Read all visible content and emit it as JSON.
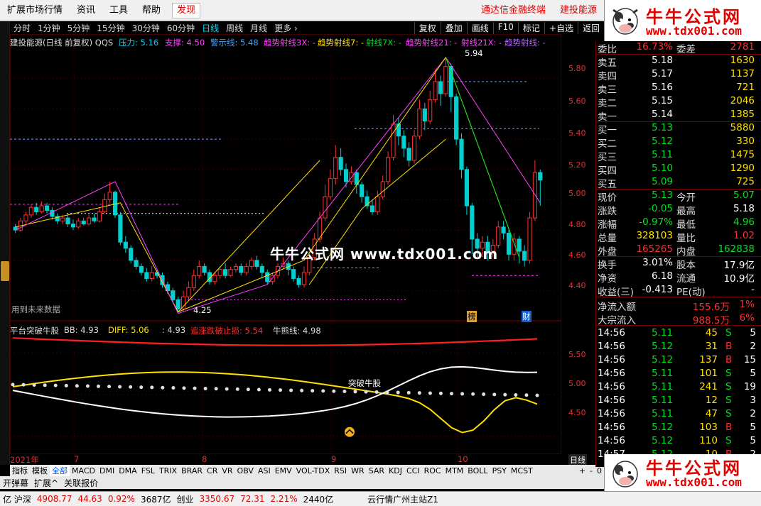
{
  "menu": {
    "items": [
      "扩展市场行情",
      "资讯",
      "工具",
      "帮助"
    ],
    "discover": "发现",
    "ad1": "通达信金融终端",
    "ad2": "建投能源"
  },
  "logo": {
    "title": "牛牛公式网",
    "url": "www.tdx001.com"
  },
  "periods": [
    "分时",
    "1分钟",
    "5分钟",
    "15分钟",
    "30分钟",
    "60分钟",
    "日线",
    "周线",
    "月线",
    "更多 ›"
  ],
  "active_period": "日线",
  "toolbar": [
    "复权",
    "叠加",
    "画线",
    "F10",
    "标记",
    "+自选",
    "返回"
  ],
  "main_legend": {
    "stock": "建投能源(日线 前复权) QQS",
    "pressure": "压力: 5.16",
    "support": "支撑: 4.50",
    "warn": "警示线: 5.48",
    "ray3": "趋势射线3X: -",
    "ray7": "趋势射线7: -",
    "ray7x": "射线7X: -",
    "ray21": "趋势射线21: -",
    "ray21x": "射线21X: -",
    "ray": "趋势射线: -"
  },
  "chart_labels": {
    "high": "5.94",
    "low": "4.25",
    "future": "用到未来数据",
    "watermark": "牛牛公式网 www.tdx001.com",
    "badge1": "榜",
    "badge2": "财"
  },
  "sub_legend": {
    "name": "平台突破牛股",
    "bb": "BB: 4.93",
    "diff": "DIFF: 5.06",
    "v3": ": 4.93",
    "stop": "追涨跌破止损: 5.54",
    "niu": "牛熊线: 4.98",
    "breakout": "突破牛股"
  },
  "x_axis": {
    "year": "2021年",
    "m7": "7",
    "m8": "8",
    "m9": "9",
    "m10": "10",
    "period_tag": "日线"
  },
  "price_axis": [
    "5.80",
    "5.60",
    "5.40",
    "5.20",
    "5.00",
    "4.80",
    "4.60",
    "4.40"
  ],
  "sub_axis": [
    "5.50",
    "5.00",
    "4.50"
  ],
  "indicator_tabs": [
    "指标",
    "模板",
    "全部",
    "MACD",
    "DMI",
    "DMA",
    "FSL",
    "TRIX",
    "BRAR",
    "CR",
    "VR",
    "OBV",
    "ASI",
    "EMV",
    "VOL-TDX",
    "RSI",
    "WR",
    "SAR",
    "KDJ",
    "CCI",
    "ROC",
    "MTM",
    "BOLL",
    "PSY",
    "MCST"
  ],
  "active_indicator": "全部",
  "bottom_tabs": [
    "开弹幕",
    "扩展^",
    "关联报价"
  ],
  "zoom_controls": [
    "+",
    "-",
    "0"
  ],
  "status": {
    "sh_label": "亿 沪深",
    "sh_value": "4908.77",
    "sh_chg": "44.63",
    "sh_pct": "0.92%",
    "sh_amt": "3687亿",
    "cy_label": "创业",
    "cy_value": "3350.67",
    "cy_chg": "72.31",
    "cy_pct": "2.21%",
    "cy_amt": "2440亿",
    "server": "云行情广州主站Z1"
  },
  "quote": {
    "weibi": {
      "label": "委比",
      "pct": "16.73%",
      "label2": "委差",
      "val": "2781"
    },
    "sell": [
      {
        "label": "卖五",
        "price": "5.18",
        "vol": "1630"
      },
      {
        "label": "卖四",
        "price": "5.17",
        "vol": "1137"
      },
      {
        "label": "卖三",
        "price": "5.16",
        "vol": "721"
      },
      {
        "label": "卖二",
        "price": "5.15",
        "vol": "2046"
      },
      {
        "label": "卖一",
        "price": "5.14",
        "vol": "1385"
      }
    ],
    "buy": [
      {
        "label": "买一",
        "price": "5.13",
        "vol": "5880"
      },
      {
        "label": "买二",
        "price": "5.12",
        "vol": "330"
      },
      {
        "label": "买三",
        "price": "5.11",
        "vol": "1475"
      },
      {
        "label": "买四",
        "price": "5.10",
        "vol": "1290"
      },
      {
        "label": "买五",
        "price": "5.09",
        "vol": "725"
      }
    ],
    "stats": [
      {
        "l1": "现价",
        "v1": "5.13",
        "c1": "green",
        "l2": "今开",
        "v2": "5.07",
        "c2": "green"
      },
      {
        "l1": "涨跌",
        "v1": "-0.05",
        "c1": "green",
        "l2": "最高",
        "v2": "5.18",
        "c2": "white"
      },
      {
        "l1": "涨幅",
        "v1": "-0.97%",
        "c1": "green",
        "l2": "最低",
        "v2": "4.96",
        "c2": "green"
      },
      {
        "l1": "总量",
        "v1": "328103",
        "c1": "yellow",
        "l2": "量比",
        "v2": "1.02",
        "c2": "red"
      },
      {
        "l1": "外盘",
        "v1": "165265",
        "c1": "red",
        "l2": "内盘",
        "v2": "162838",
        "c2": "green"
      }
    ],
    "fin": [
      {
        "l1": "换手",
        "v1": "3.01%",
        "l2": "股本",
        "v2": "17.9亿"
      },
      {
        "l1": "净资",
        "v1": "6.18",
        "l2": "流通",
        "v2": "10.9亿"
      },
      {
        "l1": "收益(三)",
        "v1": "-0.413",
        "l2": "PE(动)",
        "v2": "-"
      }
    ],
    "flows": [
      {
        "label": "净流入额",
        "val": "155.6万",
        "pct": "1%"
      },
      {
        "label": "大宗流入",
        "val": "988.5万",
        "pct": "6%"
      }
    ],
    "ticks": [
      {
        "t": "14:56",
        "p": "5.11",
        "v": "45",
        "s": "S",
        "n": "5"
      },
      {
        "t": "14:56",
        "p": "5.12",
        "v": "31",
        "s": "B",
        "n": "2"
      },
      {
        "t": "14:56",
        "p": "5.12",
        "v": "137",
        "s": "B",
        "n": "15"
      },
      {
        "t": "14:56",
        "p": "5.11",
        "v": "101",
        "s": "S",
        "n": "5"
      },
      {
        "t": "14:56",
        "p": "5.11",
        "v": "241",
        "s": "S",
        "n": "19"
      },
      {
        "t": "14:56",
        "p": "5.11",
        "v": "12",
        "s": "S",
        "n": "3"
      },
      {
        "t": "14:56",
        "p": "5.11",
        "v": "47",
        "s": "S",
        "n": "2"
      },
      {
        "t": "14:56",
        "p": "5.12",
        "v": "103",
        "s": "B",
        "n": "5"
      },
      {
        "t": "14:56",
        "p": "5.12",
        "v": "110",
        "s": "S",
        "n": "5"
      },
      {
        "t": "14:57",
        "p": "5.12",
        "v": "10",
        "s": "B",
        "n": "2"
      }
    ]
  },
  "colors": {
    "up": "#ff3030",
    "down": "#00d0d0",
    "accent": "#e00000",
    "yellow": "#ffe000",
    "magenta": "#ff40ff"
  },
  "candles": [
    [
      4.82,
      4.8,
      4.84,
      4.78
    ],
    [
      4.8,
      4.86,
      4.88,
      4.79
    ],
    [
      4.86,
      4.9,
      4.92,
      4.84
    ],
    [
      4.9,
      4.95,
      4.97,
      4.88
    ],
    [
      4.95,
      4.92,
      4.98,
      4.9
    ],
    [
      4.92,
      4.96,
      4.99,
      4.91
    ],
    [
      4.96,
      4.93,
      4.98,
      4.91
    ],
    [
      4.93,
      4.89,
      4.95,
      4.87
    ],
    [
      4.89,
      4.86,
      4.91,
      4.84
    ],
    [
      4.86,
      4.88,
      4.9,
      4.84
    ],
    [
      4.88,
      4.84,
      4.9,
      4.82
    ],
    [
      4.84,
      4.82,
      4.87,
      4.8
    ],
    [
      4.82,
      4.86,
      4.88,
      4.81
    ],
    [
      4.86,
      4.84,
      4.88,
      4.83
    ],
    [
      4.84,
      4.88,
      4.9,
      4.83
    ],
    [
      4.88,
      4.86,
      4.91,
      4.85
    ],
    [
      4.86,
      4.92,
      4.95,
      4.85
    ],
    [
      4.92,
      5.0,
      5.04,
      4.91
    ],
    [
      5.0,
      5.05,
      5.12,
      4.98
    ],
    [
      5.05,
      4.9,
      5.06,
      4.88
    ],
    [
      4.9,
      4.72,
      4.92,
      4.7
    ],
    [
      4.72,
      4.68,
      4.76,
      4.65
    ],
    [
      4.68,
      4.6,
      4.7,
      4.58
    ],
    [
      4.6,
      4.56,
      4.62,
      4.54
    ],
    [
      4.56,
      4.52,
      4.58,
      4.5
    ],
    [
      4.52,
      4.48,
      4.55,
      4.46
    ],
    [
      4.48,
      4.52,
      4.56,
      4.46
    ],
    [
      4.52,
      4.5,
      4.54,
      4.48
    ],
    [
      4.5,
      4.44,
      4.52,
      4.42
    ],
    [
      4.44,
      4.4,
      4.46,
      4.38
    ],
    [
      4.4,
      4.34,
      4.42,
      4.32
    ],
    [
      4.34,
      4.28,
      4.36,
      4.25
    ],
    [
      4.28,
      4.36,
      4.4,
      4.26
    ],
    [
      4.36,
      4.42,
      4.46,
      4.34
    ],
    [
      4.42,
      4.5,
      4.54,
      4.4
    ],
    [
      4.5,
      4.56,
      4.6,
      4.48
    ],
    [
      4.56,
      4.52,
      4.58,
      4.5
    ],
    [
      4.52,
      4.46,
      4.54,
      4.44
    ],
    [
      4.46,
      4.5,
      4.52,
      4.44
    ],
    [
      4.5,
      4.54,
      4.56,
      4.48
    ],
    [
      4.54,
      4.5,
      4.58,
      4.48
    ],
    [
      4.5,
      4.54,
      4.56,
      4.49
    ],
    [
      4.54,
      4.56,
      4.58,
      4.52
    ],
    [
      4.56,
      4.52,
      4.58,
      4.5
    ],
    [
      4.52,
      4.56,
      4.58,
      4.5
    ],
    [
      4.56,
      4.6,
      4.62,
      4.54
    ],
    [
      4.6,
      4.56,
      4.63,
      4.54
    ],
    [
      4.56,
      4.52,
      4.58,
      4.48
    ],
    [
      4.52,
      4.46,
      4.54,
      4.44
    ],
    [
      4.46,
      4.5,
      4.52,
      4.44
    ],
    [
      4.5,
      4.56,
      4.58,
      4.48
    ],
    [
      4.56,
      4.58,
      4.62,
      4.54
    ],
    [
      4.58,
      4.54,
      4.6,
      4.5
    ],
    [
      4.54,
      4.48,
      4.56,
      4.46
    ],
    [
      4.48,
      4.44,
      4.5,
      4.42
    ],
    [
      4.44,
      4.52,
      4.56,
      4.42
    ],
    [
      4.52,
      4.62,
      4.66,
      4.5
    ],
    [
      4.62,
      4.74,
      4.78,
      4.6
    ],
    [
      4.74,
      4.88,
      4.92,
      4.72
    ],
    [
      4.88,
      5.02,
      5.1,
      4.86
    ],
    [
      5.02,
      5.14,
      5.2,
      5.0
    ],
    [
      5.14,
      5.28,
      5.36,
      5.1
    ],
    [
      5.28,
      5.2,
      5.34,
      5.16
    ],
    [
      5.2,
      5.12,
      5.24,
      5.08
    ],
    [
      5.12,
      5.18,
      5.22,
      5.1
    ],
    [
      5.18,
      5.1,
      5.2,
      5.04
    ],
    [
      5.1,
      5.02,
      5.12,
      4.98
    ],
    [
      5.02,
      4.96,
      5.06,
      4.94
    ],
    [
      4.96,
      4.92,
      5.0,
      4.9
    ],
    [
      4.92,
      5.02,
      5.06,
      4.9
    ],
    [
      5.02,
      5.12,
      5.16,
      5.0
    ],
    [
      5.12,
      5.28,
      5.32,
      5.1
    ],
    [
      5.28,
      5.5,
      5.56,
      5.26
    ],
    [
      5.5,
      5.42,
      5.54,
      5.36
    ],
    [
      5.42,
      5.34,
      5.46,
      5.28
    ],
    [
      5.34,
      5.26,
      5.38,
      5.22
    ],
    [
      5.26,
      5.42,
      5.46,
      5.24
    ],
    [
      5.42,
      5.6,
      5.66,
      5.4
    ],
    [
      5.6,
      5.52,
      5.64,
      5.46
    ],
    [
      5.52,
      5.66,
      5.72,
      5.5
    ],
    [
      5.66,
      5.78,
      5.86,
      5.64
    ],
    [
      5.78,
      5.7,
      5.82,
      5.62
    ],
    [
      5.7,
      5.88,
      5.94,
      5.68
    ],
    [
      5.88,
      5.68,
      5.9,
      5.58
    ],
    [
      5.68,
      5.4,
      5.7,
      5.36
    ],
    [
      5.4,
      5.2,
      5.44,
      5.14
    ],
    [
      5.2,
      4.96,
      5.22,
      4.9
    ],
    [
      4.96,
      4.74,
      4.98,
      4.64
    ],
    [
      4.74,
      4.68,
      4.78,
      4.62
    ],
    [
      4.68,
      4.72,
      4.76,
      4.62
    ],
    [
      4.72,
      4.66,
      4.76,
      4.6
    ],
    [
      4.66,
      4.7,
      4.74,
      4.62
    ],
    [
      4.7,
      4.82,
      4.86,
      4.68
    ],
    [
      4.82,
      4.78,
      4.86,
      4.74
    ],
    [
      4.78,
      4.64,
      4.8,
      4.6
    ],
    [
      4.64,
      4.74,
      4.78,
      4.6
    ],
    [
      4.74,
      4.66,
      4.76,
      4.58
    ],
    [
      4.66,
      4.6,
      4.7,
      4.56
    ],
    [
      4.6,
      4.88,
      4.92,
      4.58
    ],
    [
      4.88,
      5.18,
      5.26,
      4.86
    ],
    [
      5.18,
      5.13,
      5.2,
      4.96
    ]
  ]
}
